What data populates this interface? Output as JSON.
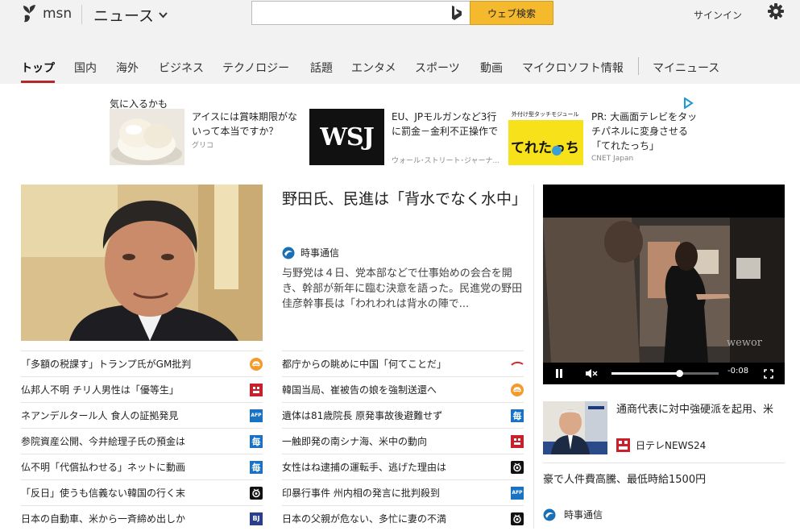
{
  "header": {
    "logo_text": "msn",
    "channel": "ニュース",
    "search_value": "",
    "search_button": "ウェブ検索",
    "signin": "サインイン"
  },
  "nav": [
    "トップ",
    "国内",
    "海外",
    "ビジネス",
    "テクノロジー",
    "話題",
    "エンタメ",
    "スポーツ",
    "動画",
    "マイクロソフト情報",
    "マイニュース"
  ],
  "ads": {
    "label": "気に入るかも",
    "items": [
      {
        "title": "アイスには賞味期限がないって本当ですか？",
        "source": "グリコ",
        "img_text": ""
      },
      {
        "title": "EU、JPモルガンなど3行に罰金－金利不正操作で",
        "source": "ウォール･ストリート･ジャーナ...",
        "img_text": "WSJ"
      },
      {
        "title": "PR: 大画面テレビをタッチパネルに変身させる「てれたっち」",
        "source": "CNET Japan",
        "img_text": "てれたっち",
        "img_sub": "外付け型タッチモジュール"
      }
    ]
  },
  "hero": {
    "title": "野田氏、民進は「背水でなく水中」",
    "source": "時事通信",
    "desc": "与野党は４日、党本部などで仕事始めの会合を開き、幹部が新年に臨む決意を語った。民進党の野田佳彦幹事長は「われわれは背水の陣で..."
  },
  "col1": [
    {
      "text": "「多額の税課す」トランプ氏がGM批判",
      "icon": "orange"
    },
    {
      "text": "仏邦人不明 チリ人男性は「優等生」",
      "icon": "red"
    },
    {
      "text": "ネアンデルタール人 食人の証拠発見",
      "icon": "afp"
    },
    {
      "text": "参院資産公開、今井絵理子氏の預金は",
      "icon": "mai"
    },
    {
      "text": "仏不明「代償払わせる」ネットに動画",
      "icon": "mai"
    },
    {
      "text": "「反日」使うも信義ない韓国の行く末",
      "icon": "tv"
    },
    {
      "text": "日本の自動車、米から一斉締め出しか",
      "icon": "bj"
    }
  ],
  "col2": [
    {
      "text": "都庁からの眺めに中国「何てことだ」",
      "icon": "sankei"
    },
    {
      "text": "韓国当局、崔被告の娘を強制送還へ",
      "icon": "orange"
    },
    {
      "text": "遺体は81歳院長 原発事故後避難せず",
      "icon": "mai"
    },
    {
      "text": "一触即発の南シナ海、米中の動向",
      "icon": "red"
    },
    {
      "text": "女性はね逮捕の運転手、逃げた理由は",
      "icon": "tv"
    },
    {
      "text": "印暴行事件 州内相の発言に批判殺到",
      "icon": "afp"
    },
    {
      "text": "日本の父親が危ない、多忙に妻の不満",
      "icon": "tv"
    }
  ],
  "icon_labels": {
    "afp": "AFP",
    "mai": "毎",
    "bj": "BJ"
  },
  "video": {
    "time": "-0:08",
    "watermark": "wewor",
    "progress": 0.63
  },
  "right": {
    "r1_title": "通商代表に対中強硬派を起用、米",
    "r1_source": "日テレNEWS24",
    "r2_title": "豪で人件費高騰、最低時給1500円",
    "r2_source": "時事通信"
  },
  "colors": {
    "accent": "#b3282d",
    "search_button": "#f5b92e"
  }
}
